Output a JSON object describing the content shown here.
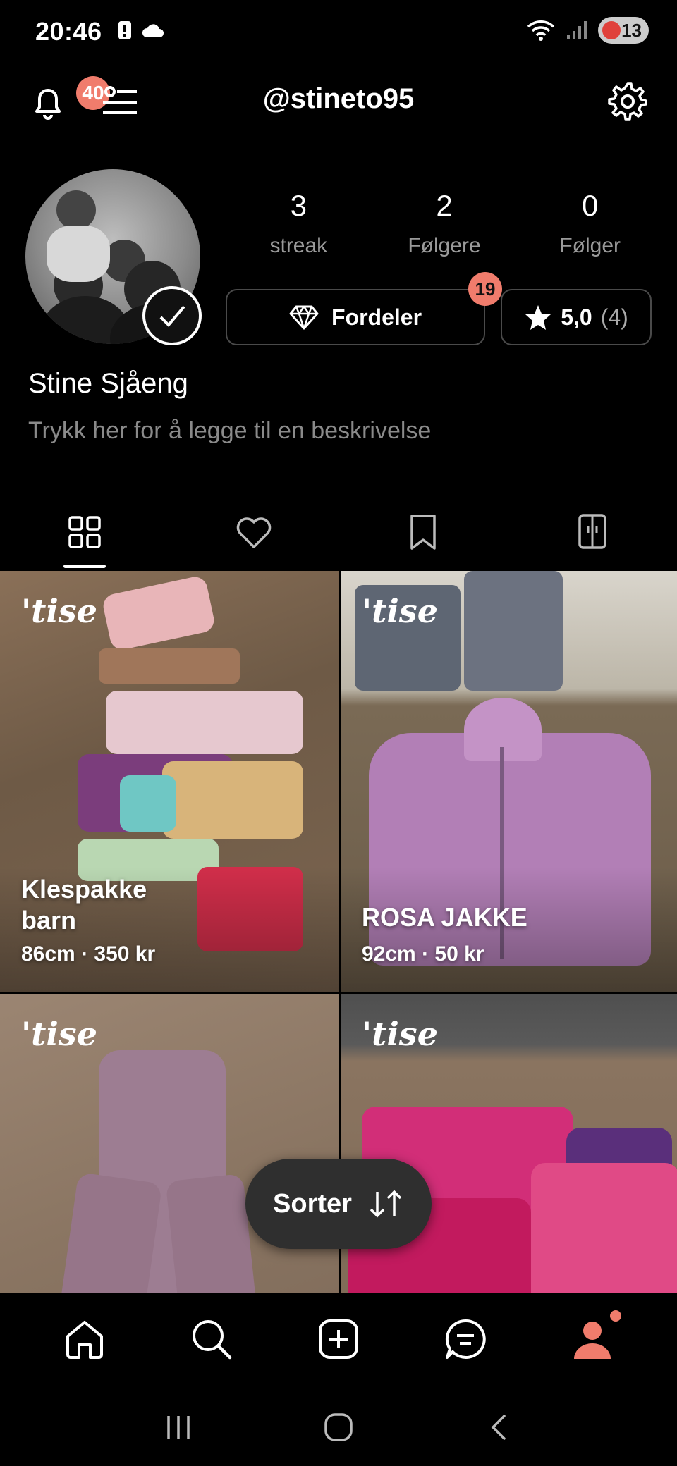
{
  "status_bar": {
    "time": "20:46",
    "battery": "13"
  },
  "header": {
    "handle": "@stineto95",
    "notification_count": "40"
  },
  "profile": {
    "stats": [
      {
        "value": "3",
        "label": "streak"
      },
      {
        "value": "2",
        "label": "Følgere"
      },
      {
        "value": "0",
        "label": "Følger"
      }
    ],
    "fordeler_label": "Fordeler",
    "fordeler_badge": "19",
    "rating": "5,0",
    "rating_count": "(4)",
    "name": "Stine Sjåeng",
    "description_placeholder": "Trykk her for å legge til en beskrivelse"
  },
  "tabs": [
    "grid-icon",
    "heart-icon",
    "bookmark-icon",
    "wardrobe-icon"
  ],
  "listings": [
    {
      "brand": "'tise",
      "title": "Klespakke barn",
      "meta": "86cm · 350 kr"
    },
    {
      "brand": "'tise",
      "title": "ROSA JAKKE",
      "meta": "92cm · 50 kr"
    },
    {
      "brand": "'tise",
      "title": "",
      "meta": ""
    },
    {
      "brand": "'tise",
      "title": "",
      "meta": ""
    }
  ],
  "sort_button": {
    "label": "Sorter"
  },
  "colors": {
    "accent": "#f07c6c",
    "background": "#000000",
    "muted": "#8a8a8a"
  }
}
